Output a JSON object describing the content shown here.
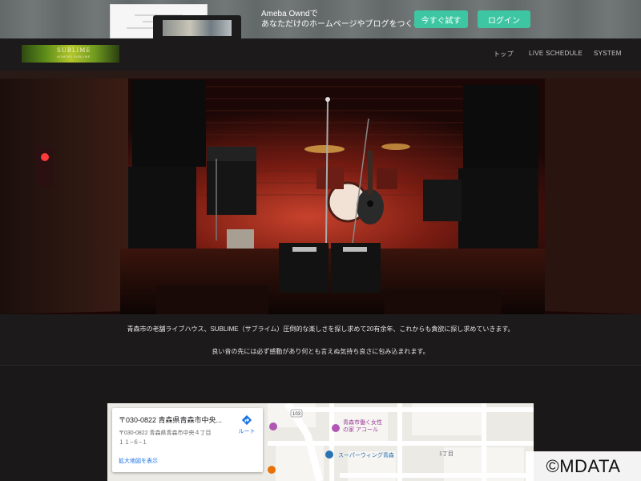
{
  "promo": {
    "line1": "Ameba Owndで",
    "line2": "あなただけのホームページやブログをつくろう",
    "try_label": "今すぐ試す",
    "login_label": "ログイン",
    "accent_color": "#3ec6a2"
  },
  "header": {
    "logo_text": "SUBLIME",
    "logo_sub": "AOMORI SUBLIME",
    "nav": [
      "トップ",
      "LIVE SCHEDULE",
      "SYSTEM"
    ]
  },
  "description": {
    "line1": "青森市の老舗ライブハウス、SUBLIME（サブライム）圧倒的な楽しさを探し求めて20有余年、これからも貪欲に探し求めていきます。",
    "line2": "良い音の先には必ず感動があり何とも言えぬ気持ち良さに包み込まれます。"
  },
  "map": {
    "title": "〒030-0822 青森県青森市中央...",
    "address_line1": "〒030-0822 青森県青森市中央４丁目",
    "address_line2": "１１−６−１",
    "route_label": "ルート",
    "enlarge_link": "拡大地図を表示",
    "road_number": "103",
    "poi_1": "青森市働く女性",
    "poi_1b": "の家 アコール",
    "poi_2": "スーパーウィング青森",
    "poi_3": "1丁目"
  },
  "watermark": "©MDATA"
}
